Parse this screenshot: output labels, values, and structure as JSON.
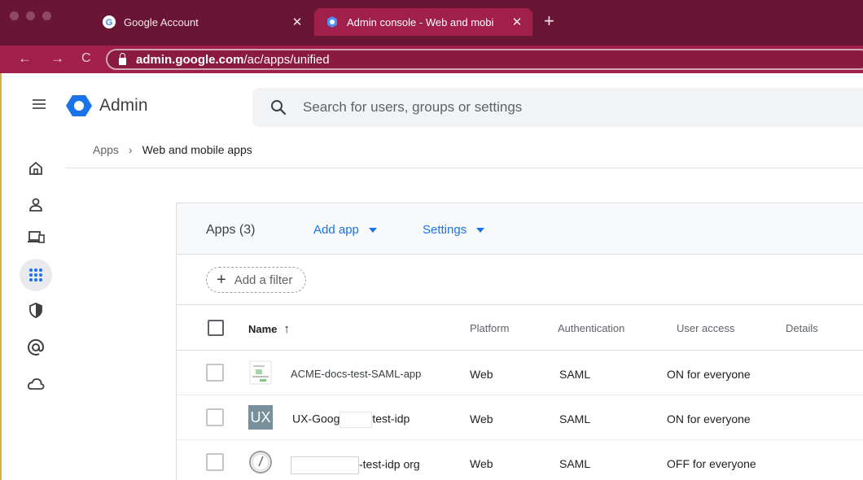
{
  "browser": {
    "tabs": [
      {
        "title": "Google Account",
        "close": "✕",
        "active": false
      },
      {
        "title": "Admin console - Web and mobi",
        "close": "✕",
        "active": true
      }
    ],
    "new_tab": "+",
    "nav": {
      "back": "←",
      "forward": "→",
      "reload": "C"
    },
    "url_host": "admin.google.com",
    "url_path": "/ac/apps/unified"
  },
  "appbar": {
    "product": "Admin",
    "search_placeholder": "Search for users, groups or settings"
  },
  "sidebar": {
    "items": [
      {
        "icon": "home-icon"
      },
      {
        "icon": "user-icon"
      },
      {
        "icon": "devices-icon"
      },
      {
        "icon": "apps-grid-icon",
        "active": true
      },
      {
        "icon": "security-shield-icon"
      },
      {
        "icon": "at-sign-icon"
      },
      {
        "icon": "cloud-icon"
      }
    ]
  },
  "breadcrumb": {
    "root": "Apps",
    "separator": "›",
    "current": "Web and mobile apps"
  },
  "card": {
    "apps_count": "Apps (3)",
    "add_app": "Add app",
    "settings": "Settings",
    "filter": {
      "plus": "+",
      "label": "Add a filter"
    }
  },
  "table": {
    "columns": {
      "name": "Name",
      "sort": "↑",
      "platform": "Platform",
      "authentication": "Authentication",
      "user_access": "User access",
      "details": "Details"
    },
    "rows": [
      {
        "name": "ACME-docs-test-SAML-app",
        "platform": "Web",
        "authentication": "SAML",
        "user_access": "ON for everyone",
        "icon": "document-thumbnail-icon"
      },
      {
        "name_prefix": "UX-Goog",
        "name_suffix": "test-idp",
        "icon_text": "UX",
        "platform": "Web",
        "authentication": "SAML",
        "user_access": "ON for everyone",
        "icon": "ux-tile-icon"
      },
      {
        "name_suffix": "-test-idp org",
        "platform": "Web",
        "authentication": "SAML",
        "user_access": "OFF for everyone",
        "icon": "gauge-icon"
      }
    ]
  },
  "colors": {
    "tabstrip": "#6b1535",
    "toolbar": "#a01f4b",
    "link": "#1a73e8",
    "admin_logo": "#1a73e8"
  }
}
